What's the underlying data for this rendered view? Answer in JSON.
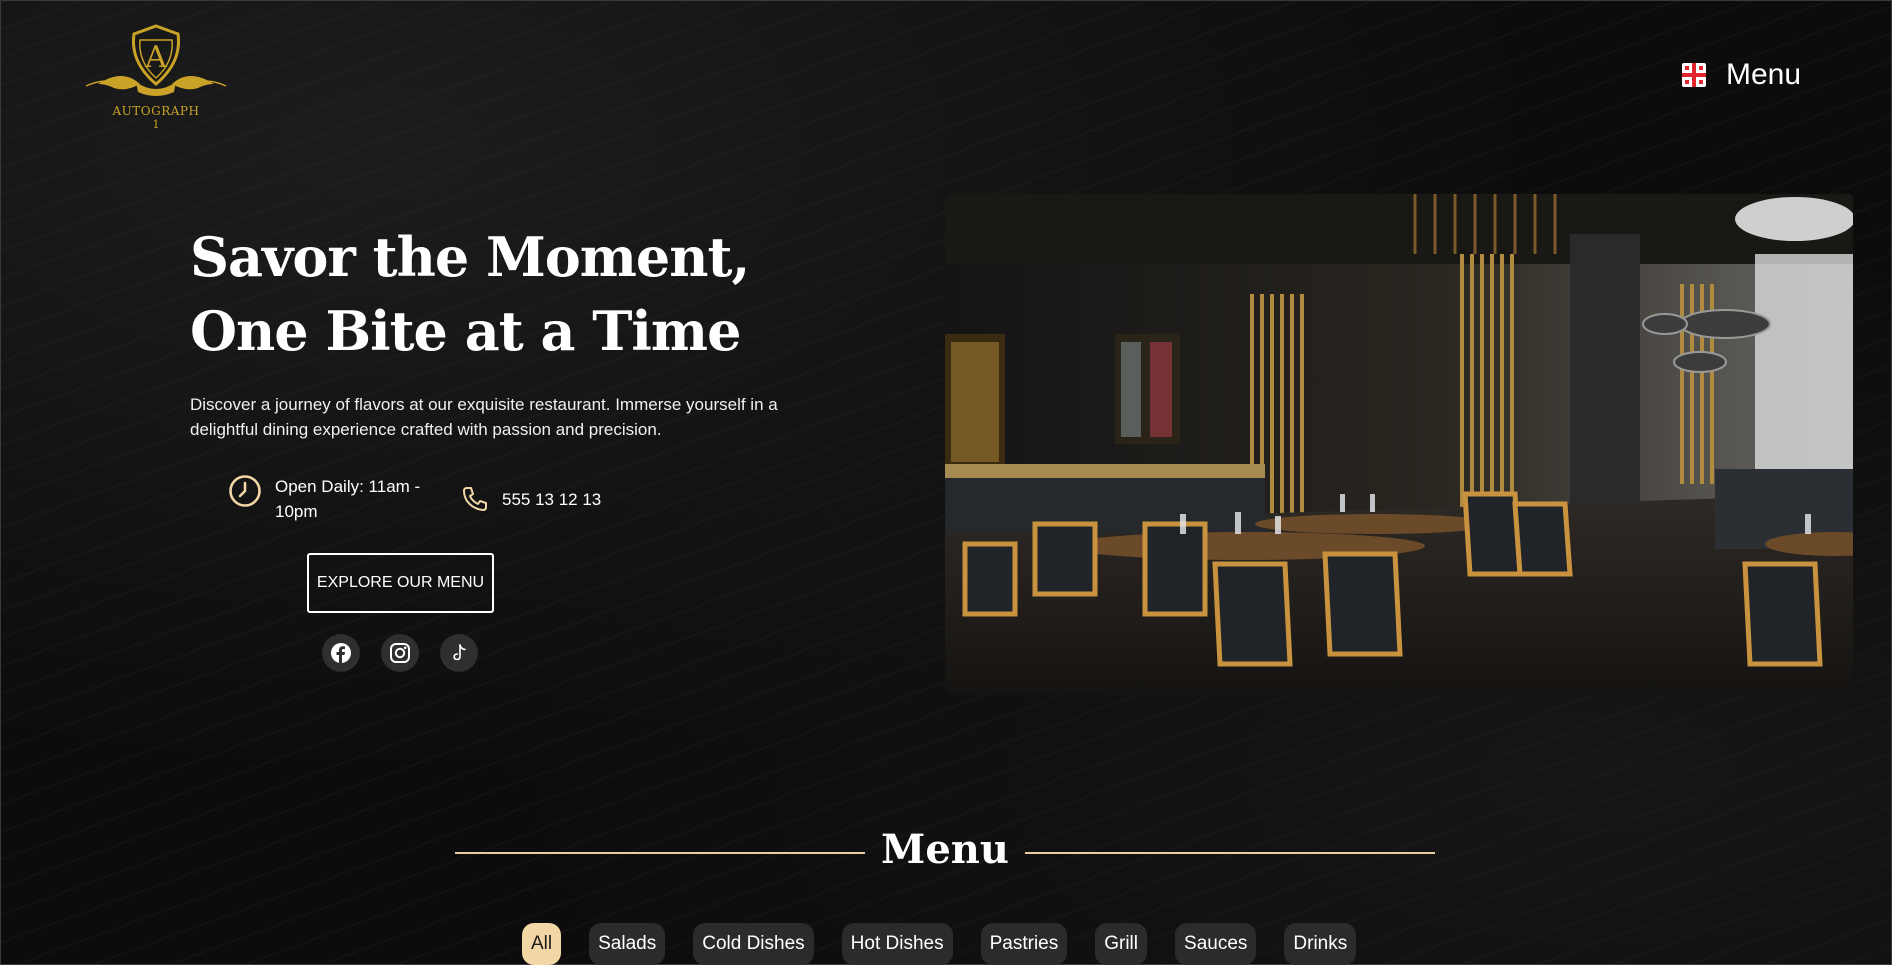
{
  "brand": {
    "logo_letter": "A",
    "logo_name": "AUTOGRAPH",
    "logo_number": "1",
    "gold": "#c9a227"
  },
  "header": {
    "menu_label": "Menu",
    "language_flag_icon": "georgia-flag-icon"
  },
  "hero": {
    "title_line1": "Savor the Moment,",
    "title_line2": "One Bite at a Time",
    "description": "Discover a journey of flavors at our exquisite restaurant. Immerse yourself in a delightful dining experience crafted with passion and precision.",
    "hours": "Open Daily: 11am - 10pm",
    "phone": "555 13 12 13",
    "cta_label": "EXPLORE OUR MENU",
    "accent": "#f2d6a6"
  },
  "socials": {
    "items": [
      "facebook-icon",
      "instagram-icon",
      "tiktok-icon"
    ]
  },
  "menu_section": {
    "heading": "Menu",
    "tabs": [
      {
        "label": "All",
        "active": true
      },
      {
        "label": "Salads"
      },
      {
        "label": "Cold Dishes"
      },
      {
        "label": "Hot Dishes"
      },
      {
        "label": "Pastries"
      },
      {
        "label": "Grill"
      },
      {
        "label": "Sauces"
      },
      {
        "label": "Drinks"
      }
    ]
  }
}
